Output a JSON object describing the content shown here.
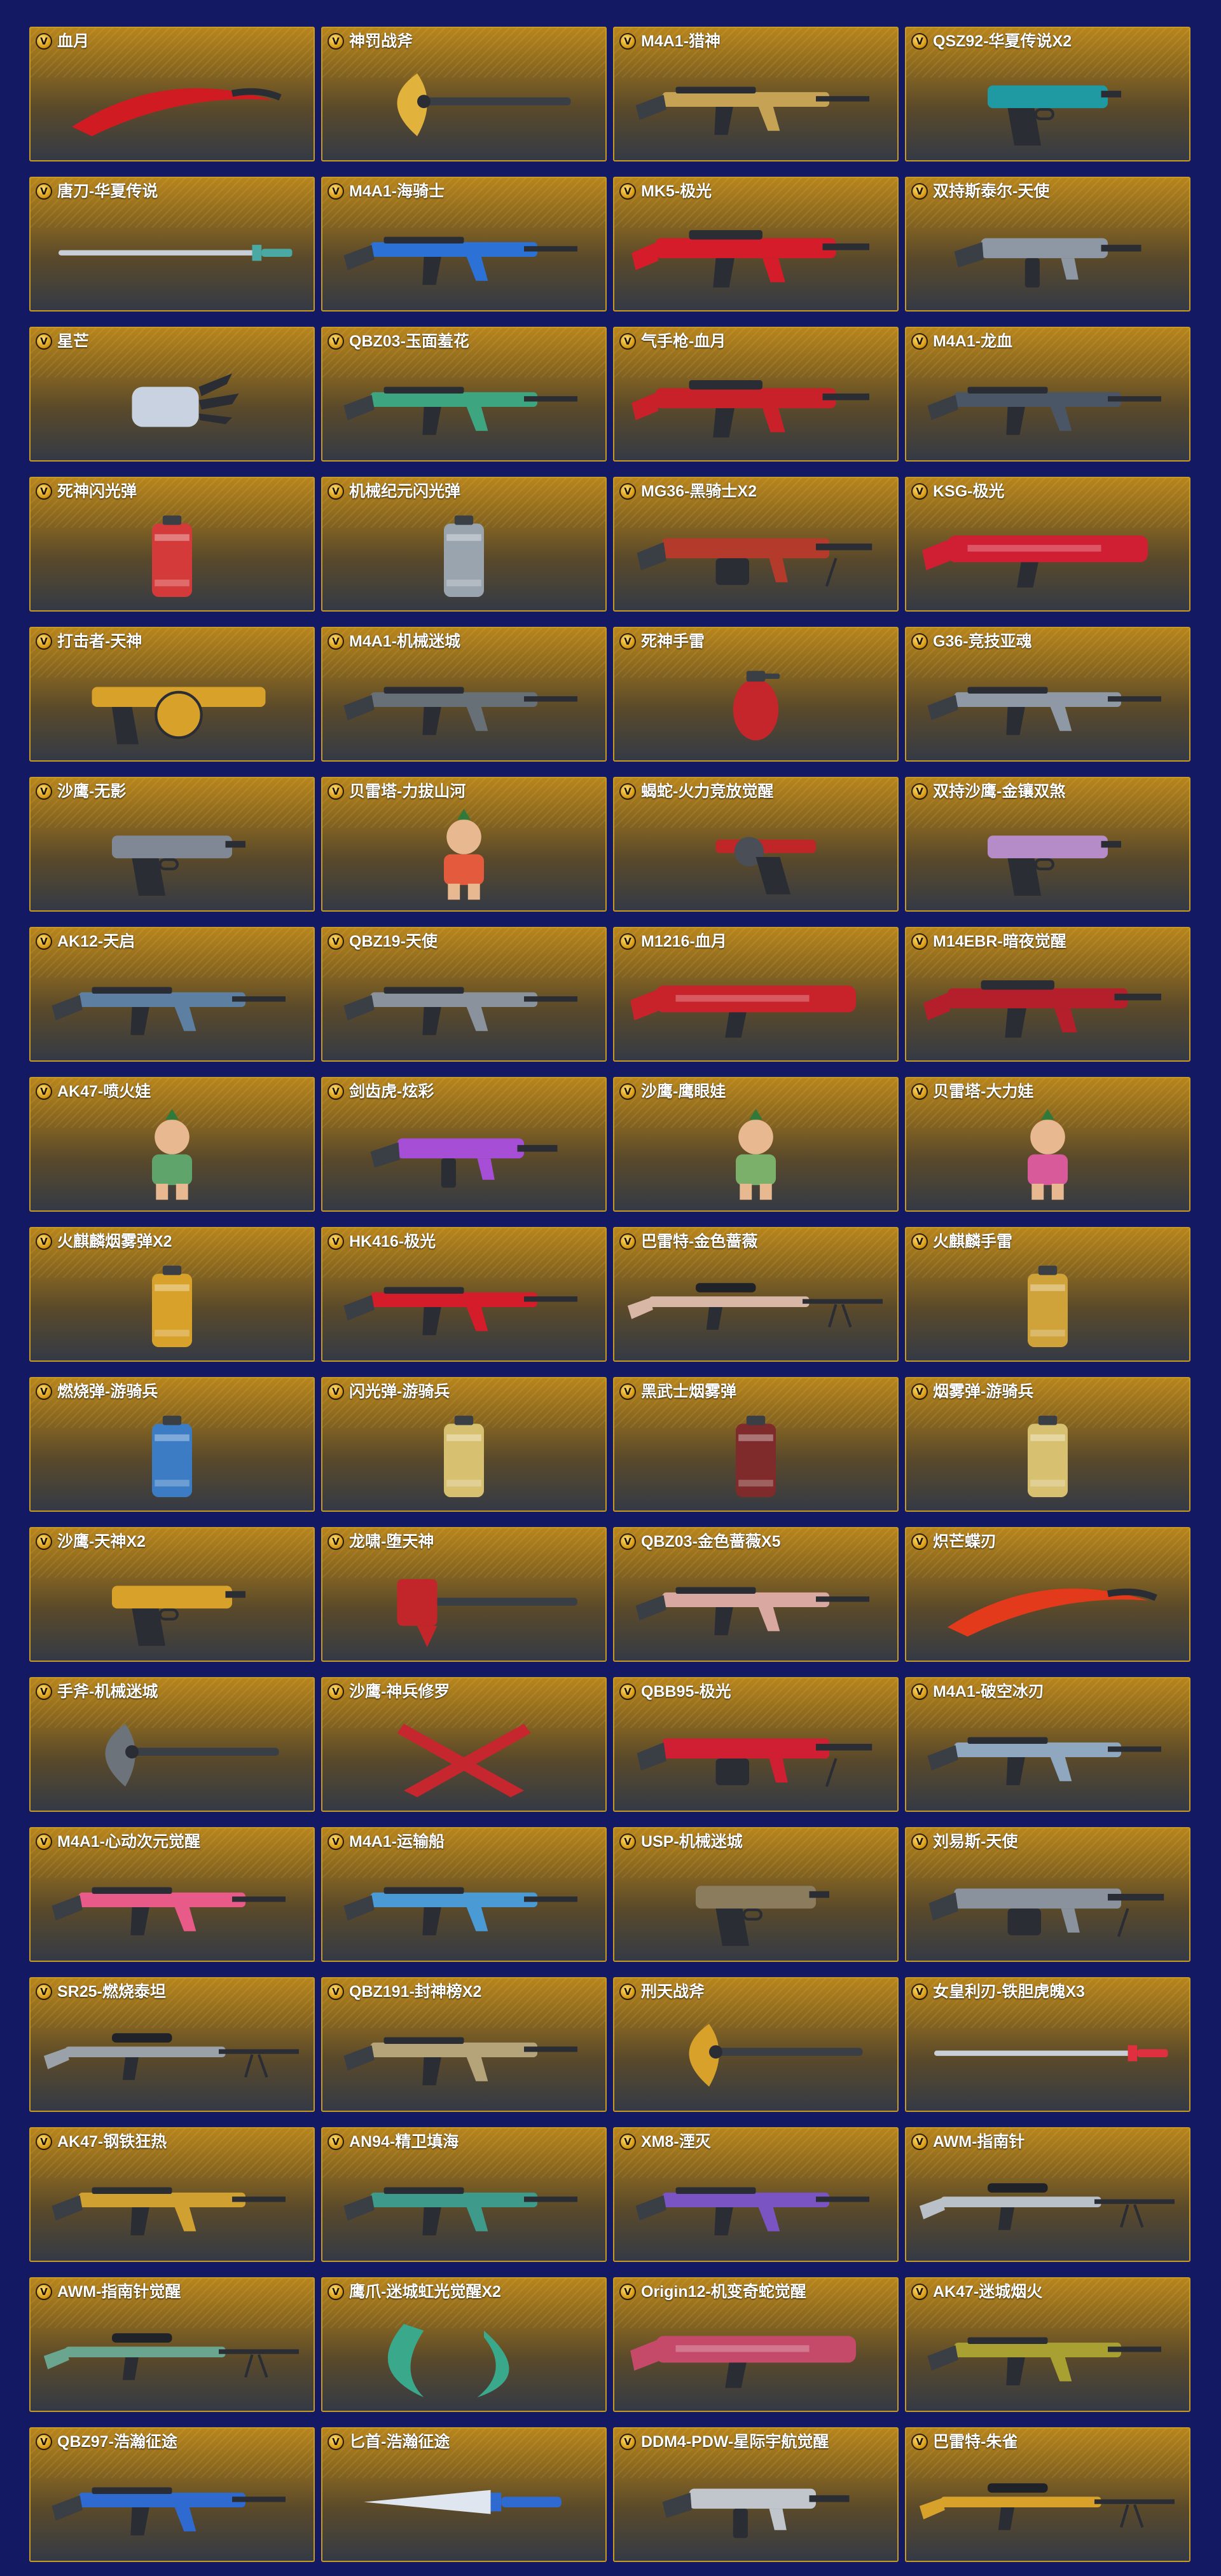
{
  "colors": {
    "page_background": "#131a63",
    "card_border": "#c69a23",
    "card_gradient_top": "#b8851d",
    "card_gradient_bottom": "#343a45",
    "badge": "#e4a818",
    "label": "#ffffff"
  },
  "badge_letter": "V",
  "items": [
    {
      "name": "血月",
      "icon": "curved-blade-icon",
      "accent": "#d01b22"
    },
    {
      "name": "神罚战斧",
      "icon": "battle-axe-icon",
      "accent": "#e2b33c"
    },
    {
      "name": "M4A1-猎神",
      "icon": "assault-rifle-icon",
      "accent": "#c6a255"
    },
    {
      "name": "QSZ92-华夏传说X2",
      "icon": "pistol-icon",
      "accent": "#1f9aa3"
    },
    {
      "name": "唐刀-华夏传说",
      "icon": "long-sword-icon",
      "accent": "#4aa9a3"
    },
    {
      "name": "M4A1-海骑士",
      "icon": "assault-rifle-icon",
      "accent": "#2b71d6"
    },
    {
      "name": "MK5-极光",
      "icon": "rifle-icon",
      "accent": "#d41c2a"
    },
    {
      "name": "双持斯泰尔-天使",
      "icon": "smg-icon",
      "accent": "#8d98a4"
    },
    {
      "name": "星芒",
      "icon": "claw-glove-icon",
      "accent": "#c9d2e0"
    },
    {
      "name": "QBZ03-玉面羞花",
      "icon": "assault-rifle-icon",
      "accent": "#3da57f"
    },
    {
      "name": "气手枪-血月",
      "icon": "rifle-icon",
      "accent": "#c8212a"
    },
    {
      "name": "M4A1-龙血",
      "icon": "assault-rifle-icon",
      "accent": "#4a5665"
    },
    {
      "name": "死神闪光弹",
      "icon": "grenade-canister-icon",
      "accent": "#d43a3a"
    },
    {
      "name": "机械纪元闪光弹",
      "icon": "grenade-canister-icon",
      "accent": "#9aa4ae"
    },
    {
      "name": "MG36-黑骑士X2",
      "icon": "machine-gun-icon",
      "accent": "#b43b2c"
    },
    {
      "name": "KSG-极光",
      "icon": "shotgun-icon",
      "accent": "#d01e33"
    },
    {
      "name": "打击者-天神",
      "icon": "drum-shotgun-icon",
      "accent": "#d7a12a"
    },
    {
      "name": "M4A1-机械迷城",
      "icon": "assault-rifle-icon",
      "accent": "#676f77"
    },
    {
      "name": "死神手雷",
      "icon": "grenade-icon",
      "accent": "#c4262c"
    },
    {
      "name": "G36-竞技亚魂",
      "icon": "assault-rifle-icon",
      "accent": "#8f98a5"
    },
    {
      "name": "沙鹰-无影",
      "icon": "pistol-icon",
      "accent": "#7f8894"
    },
    {
      "name": "贝雷塔-力拔山河",
      "icon": "character-icon",
      "accent": "#e35a3c"
    },
    {
      "name": "蝎蛇-火力竞放觉醒",
      "icon": "revolver-icon",
      "accent": "#c02628"
    },
    {
      "name": "双持沙鹰-金镶双煞",
      "icon": "pistol-icon",
      "accent": "#b68cc8"
    },
    {
      "name": "AK12-天启",
      "icon": "assault-rifle-icon",
      "accent": "#5c7fa2"
    },
    {
      "name": "QBZ19-天使",
      "icon": "assault-rifle-icon",
      "accent": "#8a939d"
    },
    {
      "name": "M1216-血月",
      "icon": "shotgun-icon",
      "accent": "#c8232a"
    },
    {
      "name": "M14EBR-暗夜觉醒",
      "icon": "rifle-icon",
      "accent": "#b51e2b"
    },
    {
      "name": "AK47-喷火娃",
      "icon": "character-icon",
      "accent": "#5ea46b"
    },
    {
      "name": "剑齿虎-炫彩",
      "icon": "smg-icon",
      "accent": "#a64ed6"
    },
    {
      "name": "沙鹰-鹰眼娃",
      "icon": "character-icon",
      "accent": "#7bb06a"
    },
    {
      "name": "贝雷塔-大力娃",
      "icon": "character-icon",
      "accent": "#d95a9a"
    },
    {
      "name": "火麒麟烟雾弹X2",
      "icon": "grenade-canister-icon",
      "accent": "#d7a12a"
    },
    {
      "name": "HK416-极光",
      "icon": "assault-rifle-icon",
      "accent": "#d41c2a"
    },
    {
      "name": "巴雷特-金色蔷薇",
      "icon": "sniper-rifle-icon",
      "accent": "#d9b7a6"
    },
    {
      "name": "火麒麟手雷",
      "icon": "grenade-canister-icon",
      "accent": "#cfa23a"
    },
    {
      "name": "燃烧弹-游骑兵",
      "icon": "grenade-canister-icon",
      "accent": "#3b7cc4"
    },
    {
      "name": "闪光弹-游骑兵",
      "icon": "grenade-canister-icon",
      "accent": "#d7c170"
    },
    {
      "name": "黑武士烟雾弹",
      "icon": "grenade-canister-icon",
      "accent": "#7f2b2b"
    },
    {
      "name": "烟雾弹-游骑兵",
      "icon": "grenade-canister-icon",
      "accent": "#d7c170"
    },
    {
      "name": "沙鹰-天神X2",
      "icon": "pistol-icon",
      "accent": "#d7a12a"
    },
    {
      "name": "龙啸-堕天神",
      "icon": "war-hammer-icon",
      "accent": "#c2262a"
    },
    {
      "name": "QBZ03-金色蔷薇X5",
      "icon": "assault-rifle-icon",
      "accent": "#d9a8a0"
    },
    {
      "name": "炽芒蝶刃",
      "icon": "curved-blade-icon",
      "accent": "#e43a1c"
    },
    {
      "name": "手斧-机械迷城",
      "icon": "battle-axe-icon",
      "accent": "#6c737a"
    },
    {
      "name": "沙鹰-神兵修罗",
      "icon": "dual-blade-icon",
      "accent": "#c6262e"
    },
    {
      "name": "QBB95-极光",
      "icon": "machine-gun-icon",
      "accent": "#d01e33"
    },
    {
      "name": "M4A1-破空冰刃",
      "icon": "assault-rifle-icon",
      "accent": "#8fa8c0"
    },
    {
      "name": "M4A1-心动次元觉醒",
      "icon": "assault-rifle-icon",
      "accent": "#e85a88"
    },
    {
      "name": "M4A1-运输船",
      "icon": "assault-rifle-icon",
      "accent": "#4a9ad6"
    },
    {
      "name": "USP-机械迷城",
      "icon": "pistol-icon",
      "accent": "#8a7c5c"
    },
    {
      "name": "刘易斯-天使",
      "icon": "machine-gun-icon",
      "accent": "#8a939d"
    },
    {
      "name": "SR25-燃烧泰坦",
      "icon": "sniper-rifle-icon",
      "accent": "#9aa1a8"
    },
    {
      "name": "QBZ191-封神榜X2",
      "icon": "assault-rifle-icon",
      "accent": "#b5a47a"
    },
    {
      "name": "刑天战斧",
      "icon": "battle-axe-icon",
      "accent": "#d7a12a"
    },
    {
      "name": "女皇利刃-铁胆虎魄X3",
      "icon": "long-sword-icon",
      "accent": "#e03040"
    },
    {
      "name": "AK47-钢铁狂热",
      "icon": "assault-rifle-icon",
      "accent": "#d0a030"
    },
    {
      "name": "AN94-精卫填海",
      "icon": "assault-rifle-icon",
      "accent": "#3e9a8a"
    },
    {
      "name": "XM8-湮灭",
      "icon": "assault-rifle-icon",
      "accent": "#7a54c2"
    },
    {
      "name": "AWM-指南针",
      "icon": "sniper-rifle-icon",
      "accent": "#b9c0c8"
    },
    {
      "name": "AWM-指南针觉醒",
      "icon": "sniper-rifle-icon",
      "accent": "#6aa58f"
    },
    {
      "name": "鹰爪-迷城虹光觉醒X2",
      "icon": "karambit-icon",
      "accent": "#3aa88a"
    },
    {
      "name": "Origin12-机变奇蛇觉醒",
      "icon": "shotgun-icon",
      "accent": "#c54a6a"
    },
    {
      "name": "AK47-迷城烟火",
      "icon": "assault-rifle-icon",
      "accent": "#a8a030"
    },
    {
      "name": "QBZ97-浩瀚征途",
      "icon": "assault-rifle-icon",
      "accent": "#2f6ad0"
    },
    {
      "name": "匕首-浩瀚征途",
      "icon": "dagger-icon",
      "accent": "#2f6ad0"
    },
    {
      "name": "DDM4-PDW-星际宇航觉醒",
      "icon": "smg-icon",
      "accent": "#c0c6cc"
    },
    {
      "name": "巴雷特-朱雀",
      "icon": "sniper-rifle-icon",
      "accent": "#d7a12a"
    }
  ]
}
